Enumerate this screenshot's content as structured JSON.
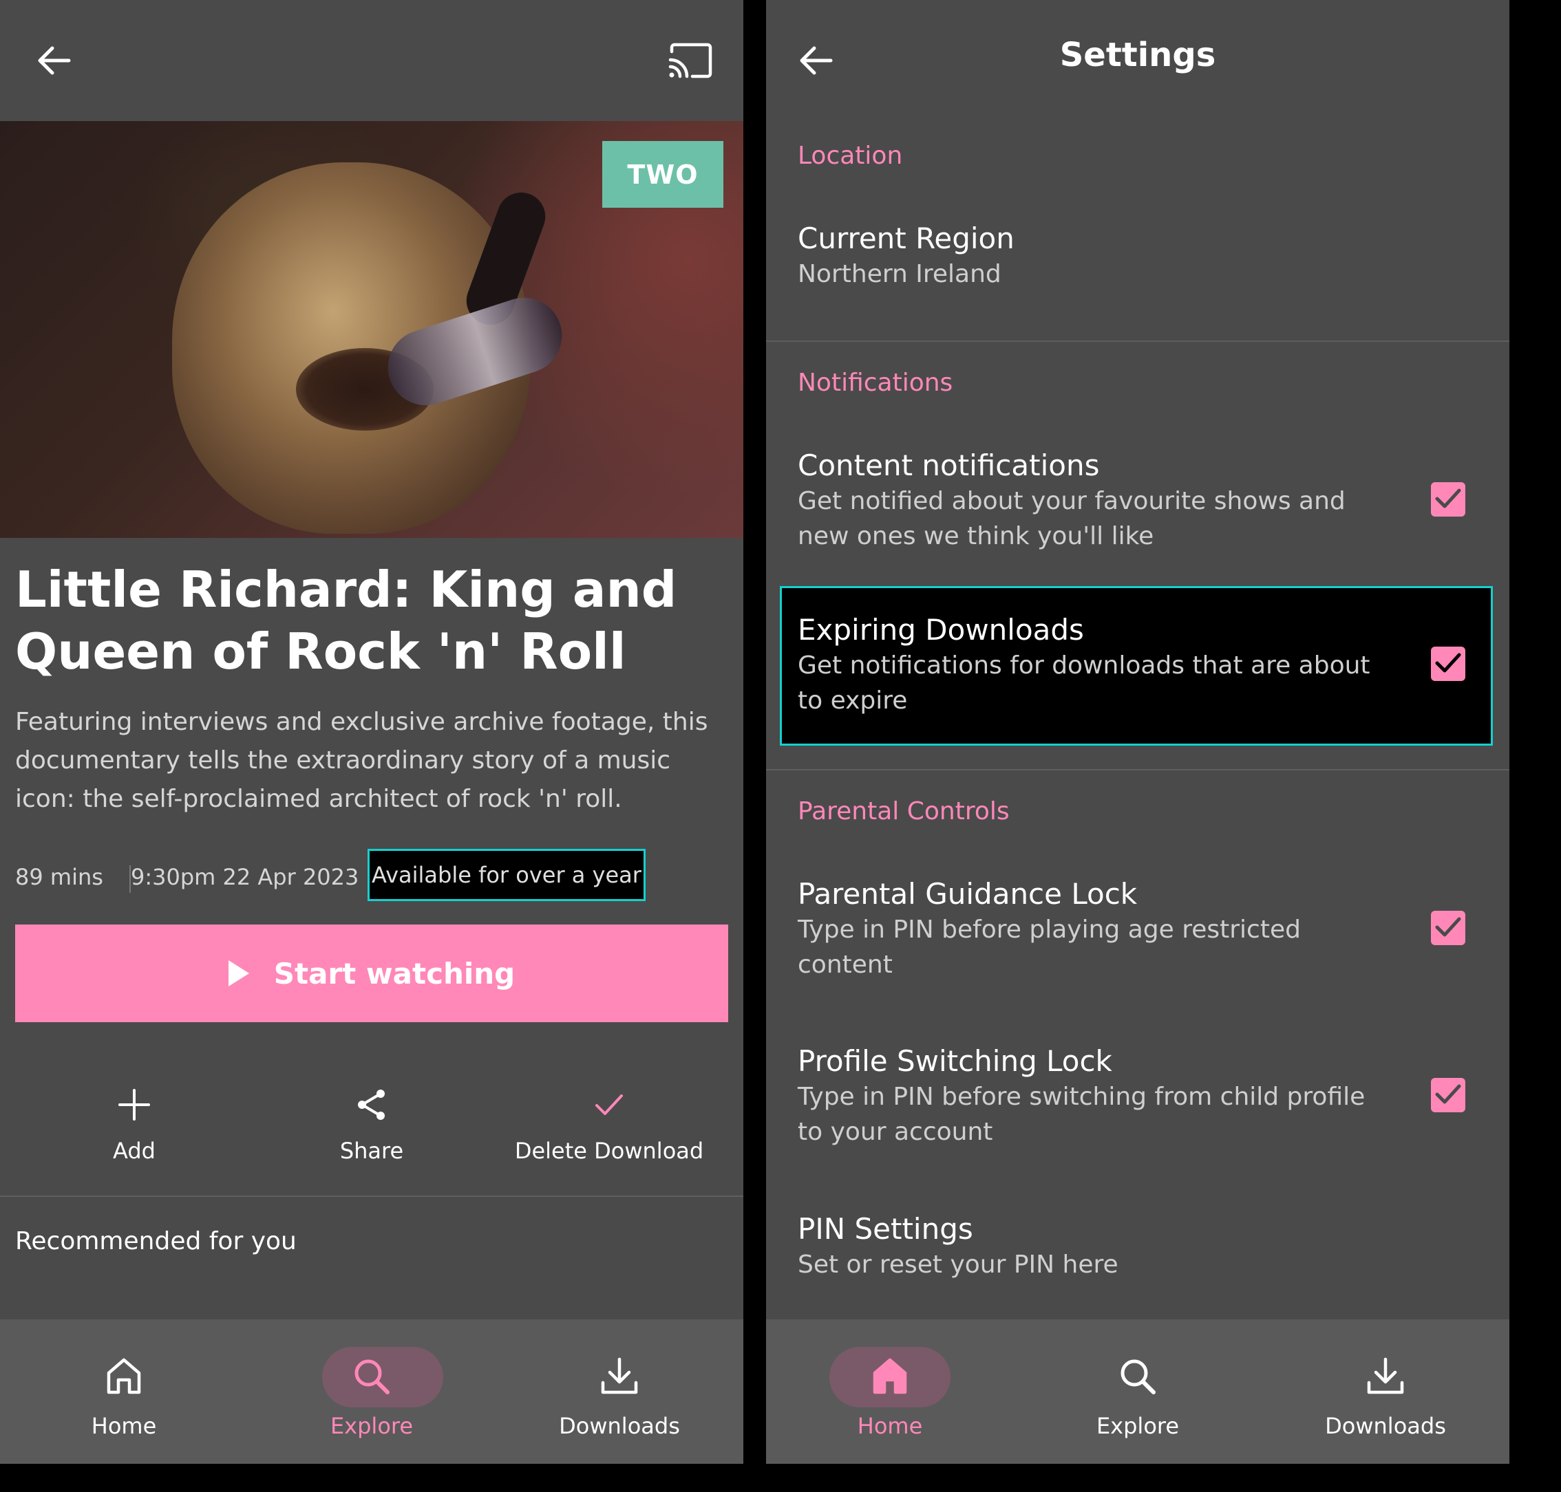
{
  "left": {
    "channel_badge": "TWO",
    "title": "Little Richard: King and Queen of Rock 'n' Roll",
    "description": "Featuring interviews and exclusive archive footage, this documentary tells the extraordinary story of a music icon: the self-proclaimed architect of rock 'n' roll.",
    "duration": "89 mins",
    "air_time": "9:30pm 22 Apr 2023",
    "availability": "Available for over a year",
    "start_label": "Start watching",
    "actions": [
      {
        "label": "Add",
        "icon": "plus-icon"
      },
      {
        "label": "Share",
        "icon": "share-icon"
      },
      {
        "label": "Delete Download",
        "icon": "check-icon"
      }
    ],
    "recommended_title": "Recommended for you",
    "nav": [
      {
        "label": "Home",
        "icon": "home-icon",
        "active": false
      },
      {
        "label": "Explore",
        "icon": "search-icon",
        "active": true
      },
      {
        "label": "Downloads",
        "icon": "download-icon",
        "active": false
      }
    ]
  },
  "right": {
    "title": "Settings",
    "sections": {
      "location": "Location",
      "notifications": "Notifications",
      "parental": "Parental Controls"
    },
    "items": {
      "current_region": {
        "title": "Current Region",
        "subtitle": "Northern Ireland"
      },
      "content_notifications": {
        "title": "Content notifications",
        "subtitle": "Get notified about your favourite shows and new ones we think you'll like",
        "checked": true
      },
      "expiring_downloads": {
        "title": "Expiring Downloads",
        "subtitle": "Get notifications for downloads that are about to expire",
        "checked": true
      },
      "parental_guidance_lock": {
        "title": "Parental Guidance Lock",
        "subtitle": "Type in PIN before playing age restricted content",
        "checked": true
      },
      "profile_switching_lock": {
        "title": "Profile Switching Lock",
        "subtitle": "Type in PIN before switching from child profile to your account",
        "checked": true
      },
      "pin_settings": {
        "title": "PIN Settings",
        "subtitle": "Set or reset your PIN here"
      }
    },
    "nav": [
      {
        "label": "Home",
        "icon": "home-icon",
        "active": true
      },
      {
        "label": "Explore",
        "icon": "search-icon",
        "active": false
      },
      {
        "label": "Downloads",
        "icon": "download-icon",
        "active": false
      }
    ]
  },
  "colors": {
    "accent": "#ff88b8",
    "focus": "#13d0d0",
    "badge": "#6cc0a8",
    "panel_bg": "#4a4a4a",
    "nav_bg": "#5a5a5a"
  }
}
